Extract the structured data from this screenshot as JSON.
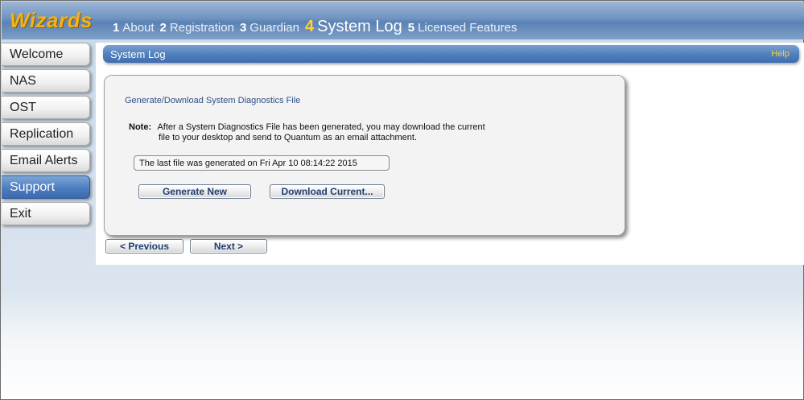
{
  "app": {
    "logo": "Wizards"
  },
  "steps": [
    {
      "num": "1",
      "label": "About"
    },
    {
      "num": "2",
      "label": "Registration"
    },
    {
      "num": "3",
      "label": "Guardian"
    },
    {
      "num": "4",
      "label": "System Log",
      "active": true
    },
    {
      "num": "5",
      "label": "Licensed Features"
    }
  ],
  "sidebar": {
    "items": [
      {
        "label": "Welcome"
      },
      {
        "label": "NAS"
      },
      {
        "label": "OST"
      },
      {
        "label": "Replication"
      },
      {
        "label": "Email Alerts"
      },
      {
        "label": "Support",
        "active": true
      },
      {
        "label": "Exit"
      }
    ]
  },
  "panel": {
    "title": "System Log",
    "help": "Help",
    "section_title": "Generate/Download System Diagnostics File",
    "note_label": "Note:",
    "note_line1": "After a System Diagnostics File has been generated, you may download the current",
    "note_line2": "file to your desktop and send to Quantum as an email attachment.",
    "last_file": "The last file was generated on Fri Apr 10 08:14:22 2015",
    "generate_button": "Generate New",
    "download_button": "Download Current..."
  },
  "footer": {
    "prev_button": "< Previous",
    "next_button": "Next >"
  },
  "colors": {
    "accent": "#4f7ebd",
    "logo": "#f2b21a",
    "active_step": "#ffd23a",
    "help": "#f6d23d"
  }
}
